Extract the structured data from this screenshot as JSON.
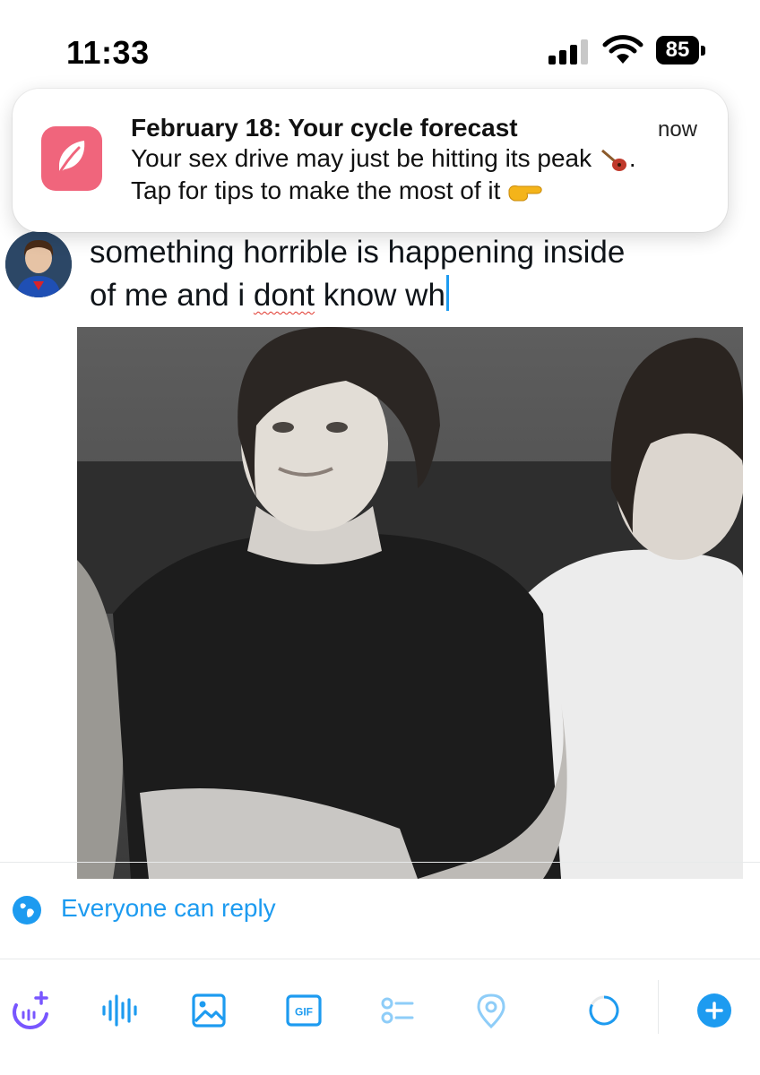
{
  "status_bar": {
    "time": "11:33",
    "battery": "85"
  },
  "notification": {
    "title": "February 18: Your cycle forecast",
    "time": "now",
    "line1": "Your sex drive may just be hitting its peak",
    "line1_end": ".",
    "line2": "Tap for tips to make the most of it",
    "app_icon": "feather-icon",
    "app_color": "#f0657c"
  },
  "composer": {
    "line1": "something horrible is happening inside",
    "line2_pre": "of me and i ",
    "line2_misspelled": "dont",
    "line2_post": " know wh"
  },
  "reply_setting": {
    "label": "Everyone can reply",
    "icon": "globe-icon"
  },
  "toolbar": {
    "items": [
      "grok-icon",
      "voice-icon",
      "image-icon",
      "gif-icon",
      "poll-icon",
      "location-icon",
      "char-count-ring",
      "add-post-button"
    ],
    "gif_label": "GIF"
  },
  "colors": {
    "accent": "#1d9bf0",
    "accent_dim": "#8ecdf8",
    "grok": "#7856ff",
    "spellcheck": "#e0352b"
  }
}
